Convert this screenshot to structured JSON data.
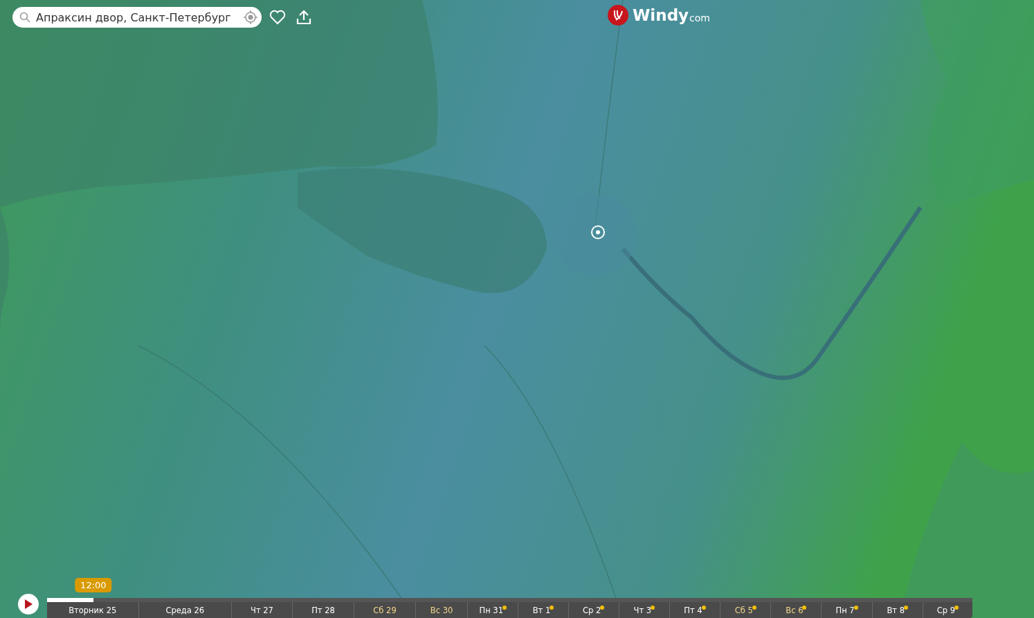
{
  "search": {
    "value": "Апраксин двор, Санкт-Петербург"
  },
  "logo": {
    "name": "Windy",
    "suffix": "com"
  },
  "timeline": {
    "current_time": "12:00",
    "level": 0.05,
    "days": [
      {
        "label": "Вторник 25",
        "weekend": false,
        "premium": false
      },
      {
        "label": "Среда 26",
        "weekend": false,
        "premium": false
      },
      {
        "label": "Чт 27",
        "weekend": false,
        "premium": false
      },
      {
        "label": "Пт 28",
        "weekend": false,
        "premium": false
      },
      {
        "label": "Сб 29",
        "weekend": true,
        "premium": false
      },
      {
        "label": "Вс 30",
        "weekend": true,
        "premium": false
      },
      {
        "label": "Пн 31",
        "weekend": false,
        "premium": true
      },
      {
        "label": "Вт 1",
        "weekend": false,
        "premium": true
      },
      {
        "label": "Ср 2",
        "weekend": false,
        "premium": true
      },
      {
        "label": "Чт 3",
        "weekend": false,
        "premium": true
      },
      {
        "label": "Пт 4",
        "weekend": false,
        "premium": true
      },
      {
        "label": "Сб 5",
        "weekend": true,
        "premium": true
      },
      {
        "label": "Вс 6",
        "weekend": true,
        "premium": true
      },
      {
        "label": "Пн 7",
        "weekend": false,
        "premium": true
      },
      {
        "label": "Вт 8",
        "weekend": false,
        "premium": true
      },
      {
        "label": "Ср 9",
        "weekend": false,
        "premium": true
      }
    ]
  }
}
